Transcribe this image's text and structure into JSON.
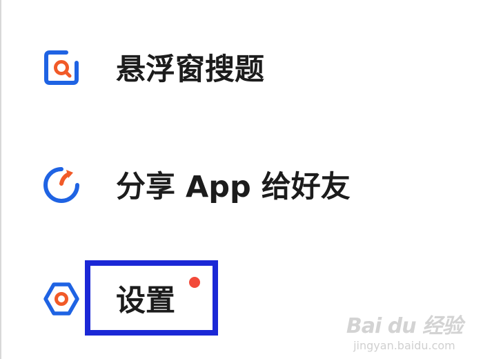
{
  "menu": {
    "items": [
      {
        "label": "悬浮窗搜题",
        "icon": "floating-window-search-icon"
      },
      {
        "label": "分享 App 给好友",
        "icon": "share-app-icon"
      },
      {
        "label": "设置",
        "icon": "settings-icon",
        "badge": "red-dot"
      }
    ]
  },
  "watermark": {
    "logo": "Bai du 经验",
    "url": "jingyan.baidu.com"
  },
  "colors": {
    "icon_blue": "#1f63e3",
    "icon_orange": "#f15a28",
    "text": "#1c1c1c",
    "highlight_box": "#1b28d6",
    "badge_red": "#f24a3a"
  }
}
